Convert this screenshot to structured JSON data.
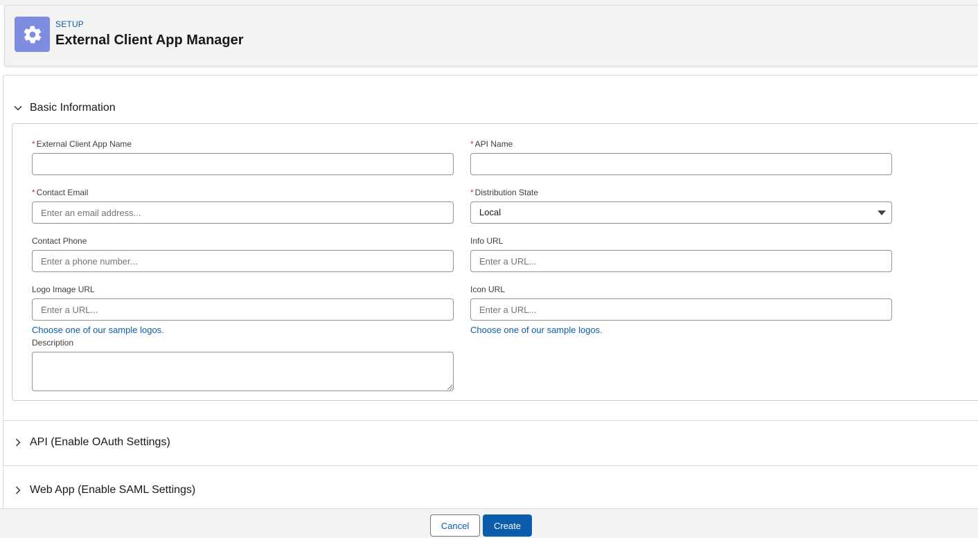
{
  "header": {
    "eyebrow": "SETUP",
    "title": "External Client App Manager",
    "icon": "gear-icon",
    "icon_bg": "#7f8de1"
  },
  "sections": {
    "basic": {
      "title": "Basic Information",
      "expanded": true
    },
    "api": {
      "title": "API (Enable OAuth Settings)",
      "expanded": false
    },
    "webapp": {
      "title": "Web App (Enable SAML Settings)",
      "expanded": false
    }
  },
  "fields": {
    "app_name": {
      "label": "External Client App Name",
      "required": "*",
      "value": "",
      "placeholder": ""
    },
    "api_name": {
      "label": "API Name",
      "required": "*",
      "value": "",
      "placeholder": ""
    },
    "contact_email": {
      "label": "Contact Email",
      "required": "*",
      "value": "",
      "placeholder": "Enter an email address..."
    },
    "distribution_state": {
      "label": "Distribution State",
      "required": "*",
      "value": "Local"
    },
    "contact_phone": {
      "label": "Contact Phone",
      "value": "",
      "placeholder": "Enter a phone number..."
    },
    "info_url": {
      "label": "Info URL",
      "value": "",
      "placeholder": "Enter a URL..."
    },
    "logo_url": {
      "label": "Logo Image URL",
      "value": "",
      "placeholder": "Enter a URL...",
      "link": "Choose one of our sample logos."
    },
    "icon_url": {
      "label": "Icon URL",
      "value": "",
      "placeholder": "Enter a URL...",
      "link": "Choose one of our sample logos."
    },
    "description": {
      "label": "Description",
      "value": ""
    }
  },
  "footer": {
    "cancel_label": "Cancel",
    "create_label": "Create"
  },
  "colors": {
    "brand": "#0b5cab",
    "required": "#c23934"
  }
}
